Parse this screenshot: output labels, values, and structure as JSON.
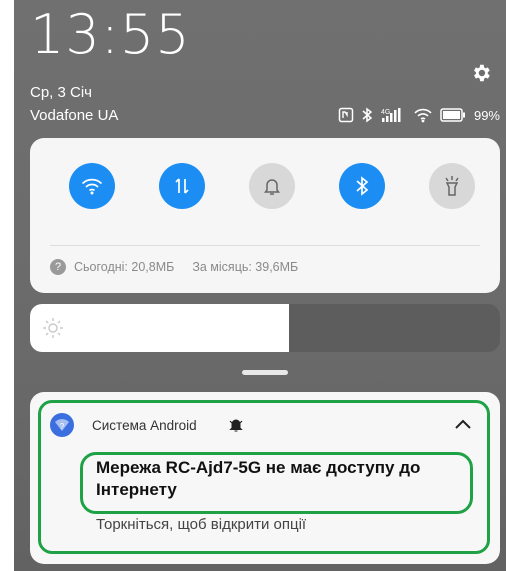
{
  "status": {
    "time": "13:55",
    "date": "Ср, 3 Січ",
    "carrier": "Vodafone UA",
    "network_type": "4G",
    "battery": "99"
  },
  "quick_settings": {
    "tiles": [
      {
        "name": "wifi-icon",
        "state": "on"
      },
      {
        "name": "data-transfer-icon",
        "state": "on"
      },
      {
        "name": "bell-icon",
        "state": "off"
      },
      {
        "name": "bluetooth-icon",
        "state": "on"
      },
      {
        "name": "flashlight-icon",
        "state": "off"
      }
    ],
    "usage_today": "Сьогодні: 20,8МБ",
    "usage_month": "За місяць: 39,6МБ",
    "brightness_fraction": 0.55
  },
  "notification": {
    "app": "Система Android",
    "title": "Мережа RC-Ajd7-5G не має доступу до Інтернету",
    "text": "Торкніться, щоб відкрити опції"
  },
  "colors": {
    "accent": "#1c8ef3",
    "highlight": "#1ea245"
  }
}
